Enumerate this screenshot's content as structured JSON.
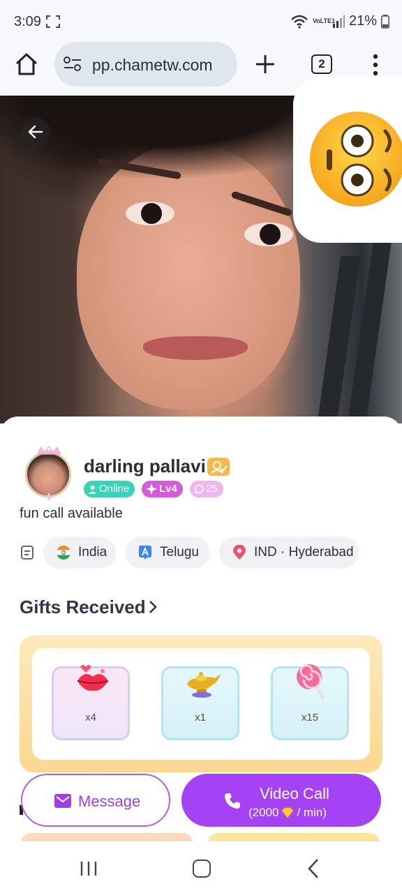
{
  "status_bar": {
    "time": "3:09",
    "network": "VoLTE1",
    "battery": "21%"
  },
  "browser": {
    "url": "pp.chametw.com",
    "tab_count": "2"
  },
  "profile": {
    "username": "darling pallavi",
    "status_badge": "Online",
    "level_badge": "Lv4",
    "fans_badge": "25",
    "bio": "fun call available",
    "country": "India",
    "language": "Telugu",
    "location": "IND · Hyderabad"
  },
  "gifts": {
    "title": "Gifts Received",
    "items": [
      {
        "icon": "lips-gift-icon",
        "count": "x4"
      },
      {
        "icon": "magic-lamp-gift-icon",
        "count": "x1"
      },
      {
        "icon": "lollipop-gift-icon",
        "count": "x15"
      }
    ]
  },
  "actions": {
    "message_label": "Message",
    "video_call_label": "Video Call",
    "price_prefix": "(2000",
    "price_suffix": " / min)"
  },
  "colors": {
    "accent_purple": "#a542f4",
    "online_green": "#39d4b8",
    "level_pink": "#d65bd9",
    "gift_panel_gold": "#fbd88f"
  }
}
